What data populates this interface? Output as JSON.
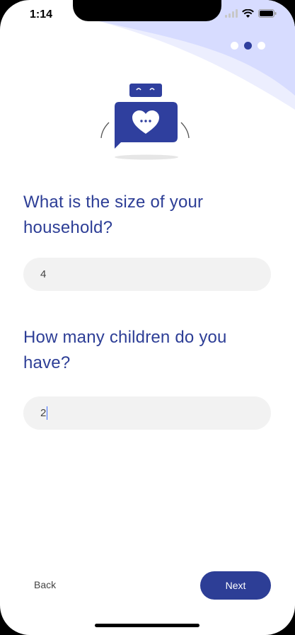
{
  "status_bar": {
    "time": "1:14"
  },
  "pager": {
    "total": 3,
    "active_index": 1
  },
  "questions": [
    {
      "label": "What is the size of your household?",
      "value": "4"
    },
    {
      "label": "How many children do you have?",
      "value": "2"
    }
  ],
  "footer": {
    "back_label": "Back",
    "next_label": "Next"
  },
  "colors": {
    "primary": "#2d3e96",
    "wave": "#d7dcff",
    "field_bg": "#f2f2f2"
  }
}
